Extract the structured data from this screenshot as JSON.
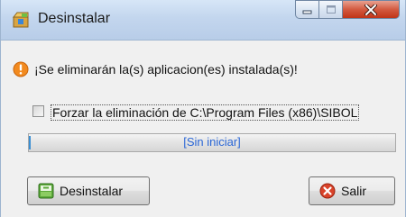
{
  "window": {
    "title": "Desinstalar",
    "title_icon": "installer-box-icon",
    "controls": [
      "minimize-icon",
      "maximize-icon",
      "close-icon"
    ]
  },
  "message": {
    "icon": "warning-icon",
    "text": "¡Se eliminarán la(s) aplicacion(es) instalada(s)!"
  },
  "force_option": {
    "checked": false,
    "label": "Forzar la eliminación de C:\\Program Files (x86)\\SIBOL"
  },
  "progress": {
    "status_text": "[Sin iniciar]",
    "value": 0
  },
  "buttons": {
    "uninstall_label": "Desinstalar",
    "uninstall_icon": "uninstall-icon",
    "exit_label": "Salir",
    "exit_icon": "close-circle-icon"
  },
  "colors": {
    "accent_text": "#2b67d6",
    "close_button": "#c84a2f",
    "warning": "#f28a1f"
  }
}
